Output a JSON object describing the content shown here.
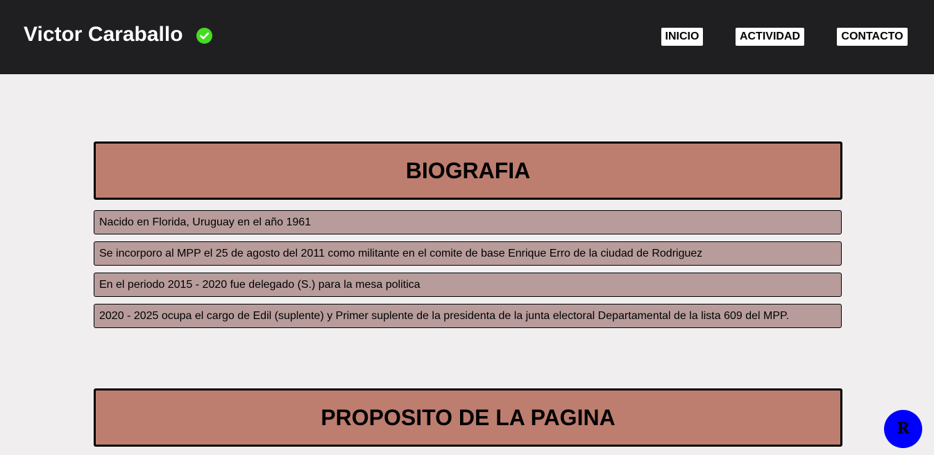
{
  "header": {
    "title": "Victor Caraballo",
    "verified_icon": "check-circle-icon",
    "verified_color": "#44dd22",
    "nav": [
      {
        "label": "INICIO"
      },
      {
        "label": "ACTIVIDAD"
      },
      {
        "label": "CONTACTO"
      }
    ]
  },
  "biografia": {
    "heading": "BIOGRAFIA",
    "items": [
      "Nacido en Florida, Uruguay en el año 1961",
      "Se incorporo al MPP el 25 de agosto del 2011 como militante en el comite de base Enrique Erro de la ciudad de Rodriguez",
      "En el periodo 2015 - 2020 fue delegado (S.) para la mesa politica",
      "2020 - 2025 ocupa el cargo de Edil (suplente) y Primer suplente de la presidenta de la junta electoral Departamental de la lista 609 del MPP."
    ]
  },
  "proposito": {
    "heading": "PROPOSITO DE LA PAGINA"
  },
  "floating_button": {
    "label": "R",
    "color": "#0000ff"
  },
  "colors": {
    "header_bg": "#1f1f22",
    "page_bg": "#f0eeee",
    "section_heading_bg": "#bd7e6f",
    "item_bg": "#b89c9c"
  }
}
